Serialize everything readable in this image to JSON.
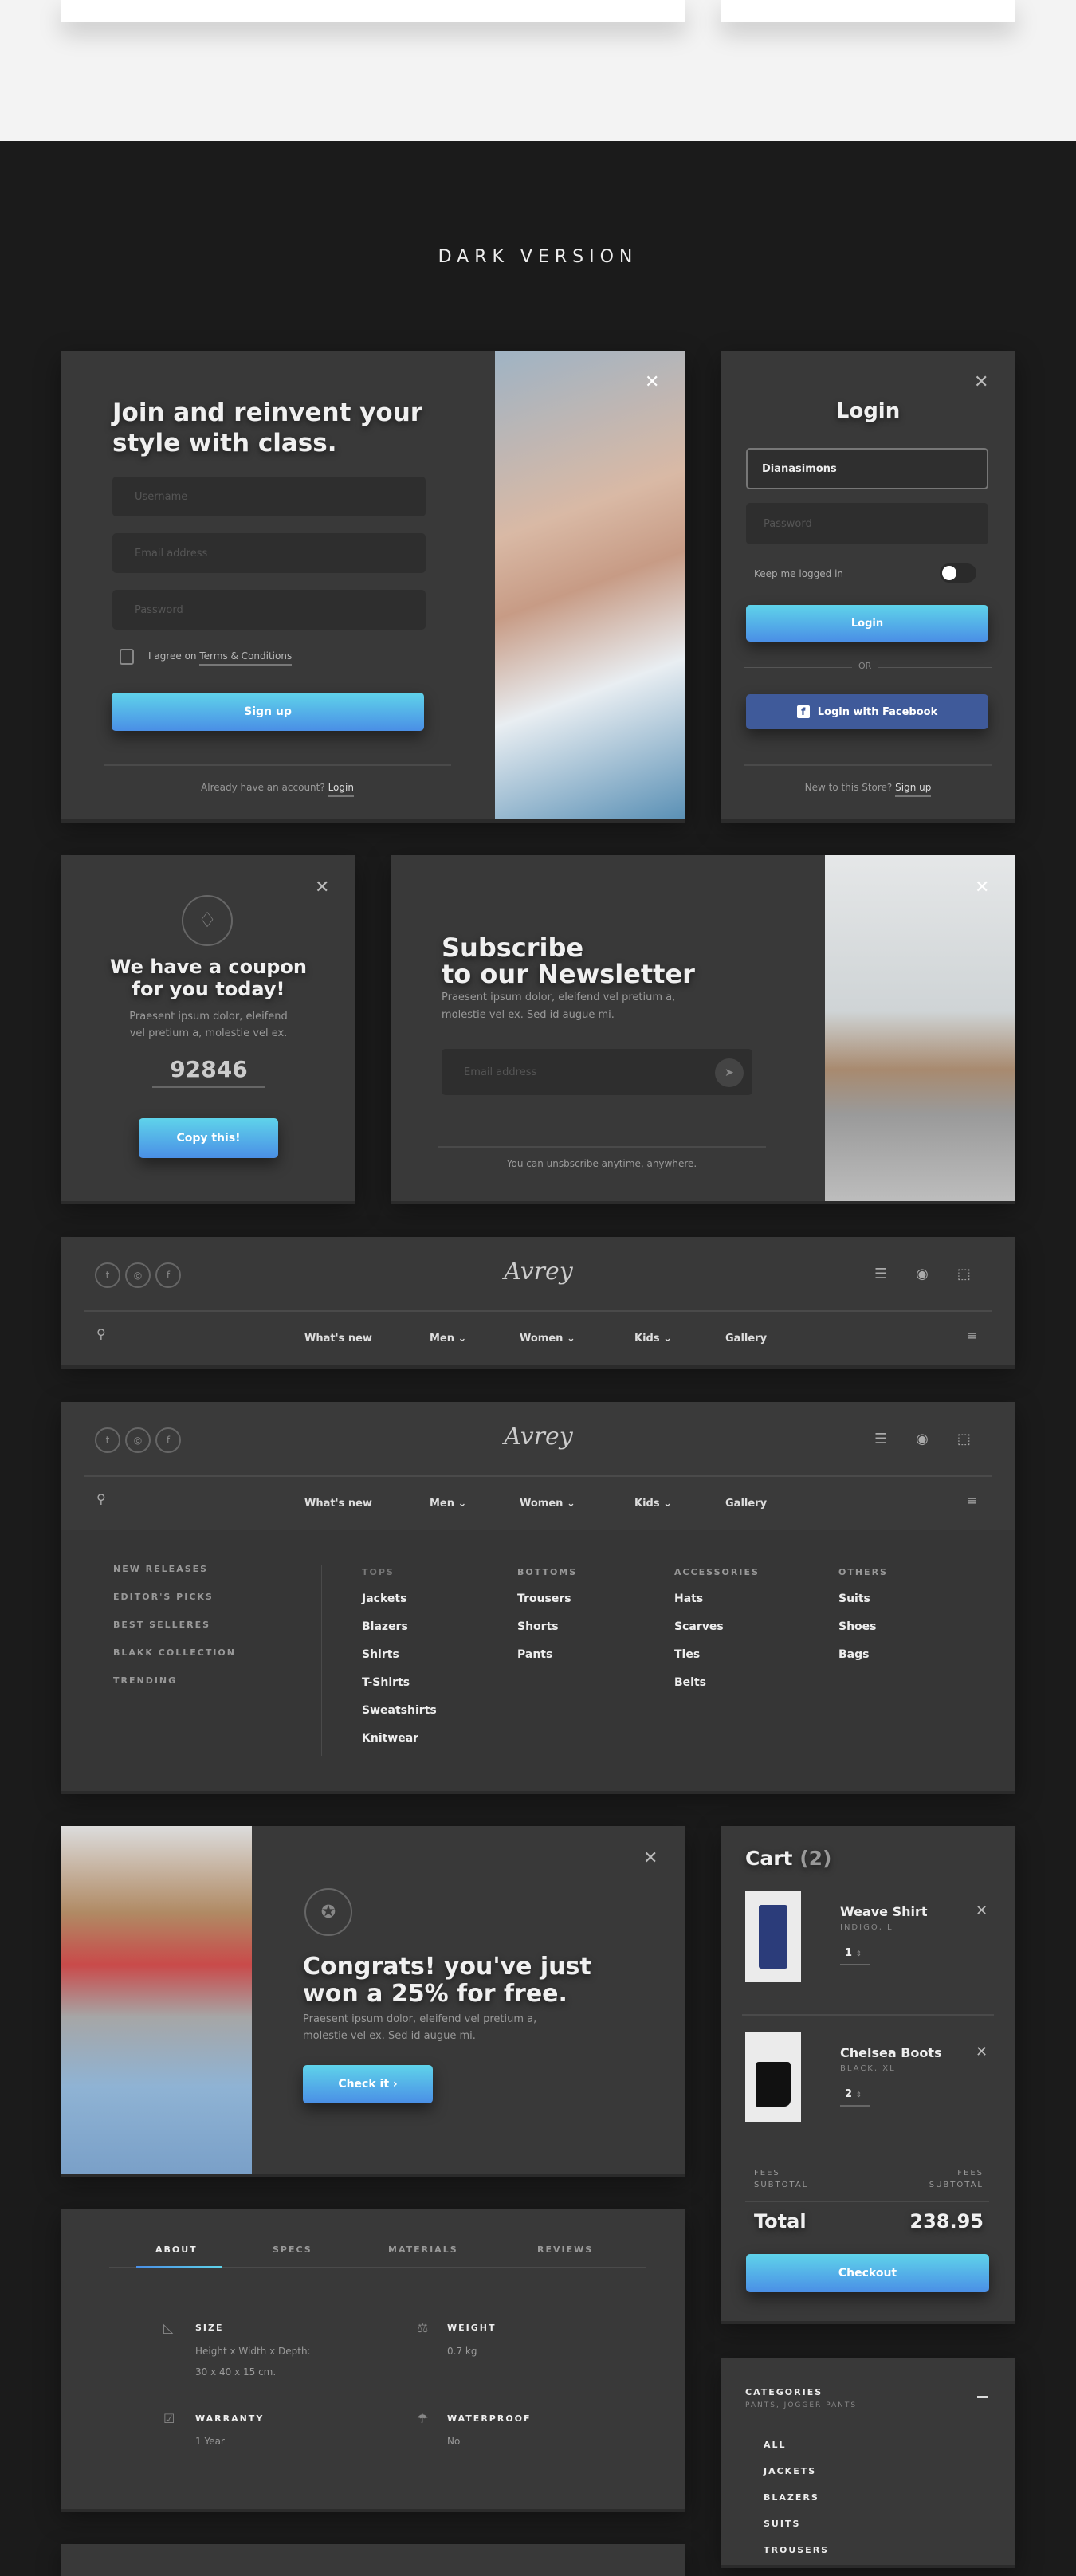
{
  "section_title": "DARK VERSION",
  "signup": {
    "title_line1": "Join and reinvent your",
    "title_line2": "style with class.",
    "username_placeholder": "Username",
    "email_placeholder": "Email address",
    "password_placeholder": "Password",
    "agree_text": "I agree on",
    "terms_link": "Terms & Conditions",
    "signup_button": "Sign up",
    "footer_text": "Already have an account?",
    "login_link": "Login"
  },
  "login": {
    "title": "Login",
    "username_value": "Dianasimons",
    "password_placeholder": "Password",
    "keep_logged": "Keep me logged in",
    "keep_logged_on": false,
    "login_button": "Login",
    "or": "OR",
    "facebook_button": "Login with Facebook",
    "footer_text": "New to this Store?",
    "signup_link": "Sign up"
  },
  "coupon": {
    "title_line1": "We have a coupon",
    "title_line2": "for you today!",
    "body_line1": "Praesent ipsum dolor, eleifend",
    "body_line2": "vel pretium a, molestie vel ex.",
    "code": "92846",
    "copy_button": "Copy this!"
  },
  "newsletter": {
    "title_line1": "Subscribe",
    "title_line2": "to our Newsletter",
    "body_line1": "Praesent ipsum dolor, eleifend vel pretium a,",
    "body_line2": "molestie vel ex. Sed id augue mi.",
    "email_placeholder": "Email address",
    "footer": "You can unsbscribe anytime, anywhere."
  },
  "nav": {
    "brand": "Avrey",
    "items": [
      {
        "label": "What's new",
        "dropdown": false
      },
      {
        "label": "Men",
        "dropdown": true
      },
      {
        "label": "Women",
        "dropdown": true
      },
      {
        "label": "Kids",
        "dropdown": true
      },
      {
        "label": "Gallery",
        "dropdown": false
      }
    ],
    "chevron": "⌄"
  },
  "mega": {
    "side": [
      "NEW RELEASES",
      "EDITOR'S PICKS",
      "BEST SELLERES",
      "BLAKK COLLECTION",
      "TRENDING"
    ],
    "columns": [
      {
        "title": "TOPS",
        "items": [
          "Jackets",
          "Blazers",
          "Shirts",
          "T-Shirts",
          "Sweatshirts",
          "Knitwear"
        ]
      },
      {
        "title": "BOTTOMS",
        "items": [
          "Trousers",
          "Shorts",
          "Pants"
        ]
      },
      {
        "title": "ACCESSORIES",
        "items": [
          "Hats",
          "Scarves",
          "Ties",
          "Belts"
        ]
      },
      {
        "title": "OTHERS",
        "items": [
          "Suits",
          "Shoes",
          "Bags"
        ]
      }
    ]
  },
  "congrats": {
    "title_line1": "Congrats! you've just",
    "title_line2": "won a 25% for free.",
    "body_line1": "Praesent ipsum dolor, eleifend vel pretium a,",
    "body_line2": "molestie vel ex. Sed id augue mi.",
    "button": "Check it ›"
  },
  "cart": {
    "title": "Cart",
    "count": "(2)",
    "items": [
      {
        "name": "Weave Shirt",
        "variant": "INDIGO, L",
        "qty": "1"
      },
      {
        "name": "Chelsea Boots",
        "variant": "BLACK, XL",
        "qty": "2"
      }
    ],
    "fees_left": "FEES",
    "subtotal_left": "SUBTOTAL",
    "fees_right": "FEES",
    "subtotal_right": "SUBTOTAL",
    "total_label": "Total",
    "total_value": "238.95",
    "checkout": "Checkout"
  },
  "tabs": {
    "items": [
      "ABOUT",
      "SPECS",
      "MATERIALS",
      "REVIEWS"
    ],
    "active": "ABOUT",
    "specs": [
      {
        "label": "SIZE",
        "value1": "Height x Width x Depth:",
        "value2": "30 x 40 x 15 cm."
      },
      {
        "label": "WEIGHT",
        "value1": "0.7 kg"
      },
      {
        "label": "WARRANTY",
        "value1": "1 Year"
      },
      {
        "label": "WATERPROOF",
        "value1": "No"
      }
    ]
  },
  "categories": {
    "title": "CATEGORIES",
    "subtitle": "PANTS, JOGGER PANTS",
    "items": [
      "ALL",
      "JACKETS",
      "BLAZERS",
      "SUITS",
      "TROUSERS"
    ]
  },
  "colors": {
    "accent_from": "#5fd3ea",
    "accent_to": "#4a8fe6",
    "facebook": "#3f5a9a",
    "card": "#393939",
    "bg": "#1b1b1b"
  }
}
